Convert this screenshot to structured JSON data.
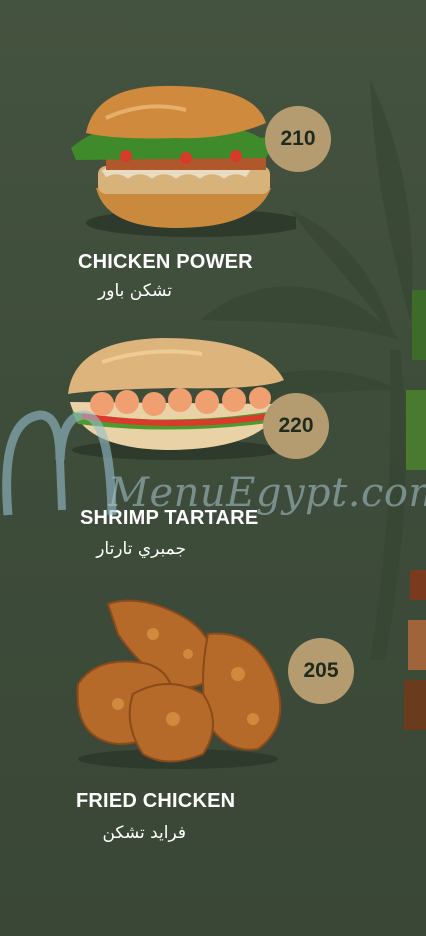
{
  "items": [
    {
      "name_en": "CHICKEN POWER",
      "name_ar": "تشكن باور",
      "price": "210"
    },
    {
      "name_en": "SHRIMP TARTARE",
      "name_ar": "جمبري تارتار",
      "price": "220"
    },
    {
      "name_en": "FRIED CHICKEN",
      "name_ar": "فرايد تشكن",
      "price": "205"
    }
  ],
  "watermark": {
    "text": "MenuEgypt.com"
  },
  "colors": {
    "background": "#3f4e3b",
    "price_badge": "#b59c70",
    "text": "#ffffff"
  }
}
